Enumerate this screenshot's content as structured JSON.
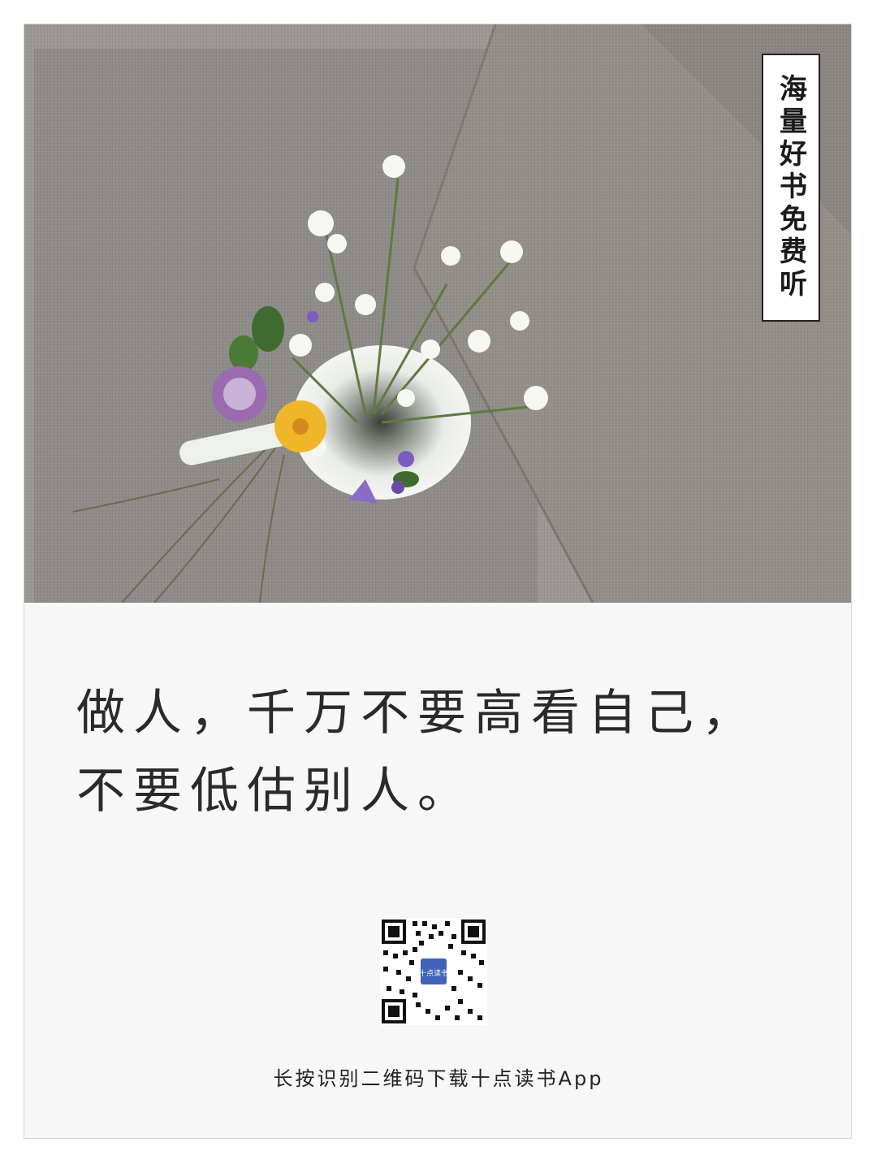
{
  "badge": {
    "text": "海量好书免费听"
  },
  "quote": {
    "line1": "做人，千万不要高看自己，",
    "line2": "不要低估别人。"
  },
  "qr": {
    "logo_text": "十点读书"
  },
  "caption": {
    "text": "长按识别二维码下载十点读书App"
  },
  "colors": {
    "linen": "#8f8d8a",
    "linen_light": "#a3a09c",
    "card": "#f7f7f7",
    "text": "#2a2a2a"
  }
}
